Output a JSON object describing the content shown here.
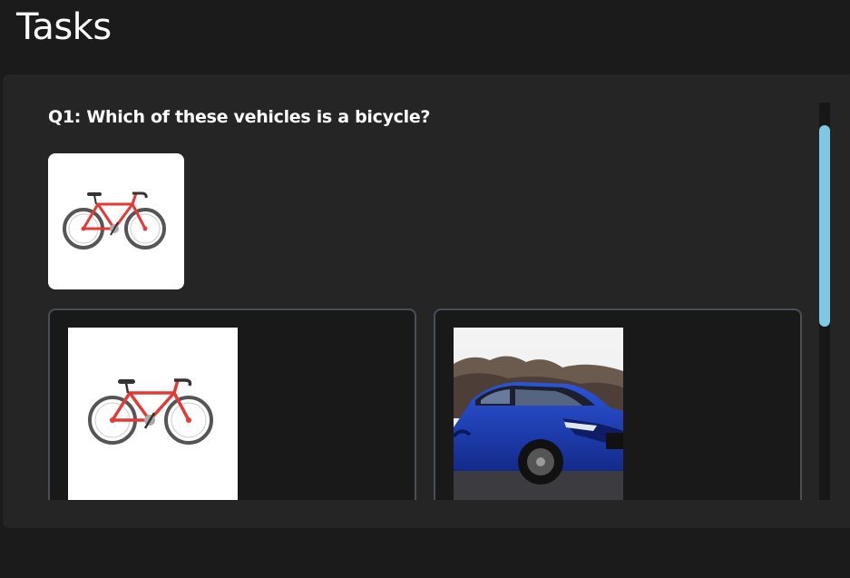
{
  "header": {
    "title": "Tasks"
  },
  "task": {
    "question": "Q1: Which of these vehicles is a bicycle?",
    "reference_image": "bicycle",
    "options": [
      {
        "image": "bicycle"
      },
      {
        "image": "blue-car"
      }
    ]
  },
  "colors": {
    "background": "#1b1b1b",
    "panel": "#252525",
    "card": "#191919",
    "card_border": "#4a4f57",
    "scrollbar_thumb": "#7ec8e3",
    "bicycle_frame": "#e53935",
    "car_body": "#1f3fb8"
  }
}
